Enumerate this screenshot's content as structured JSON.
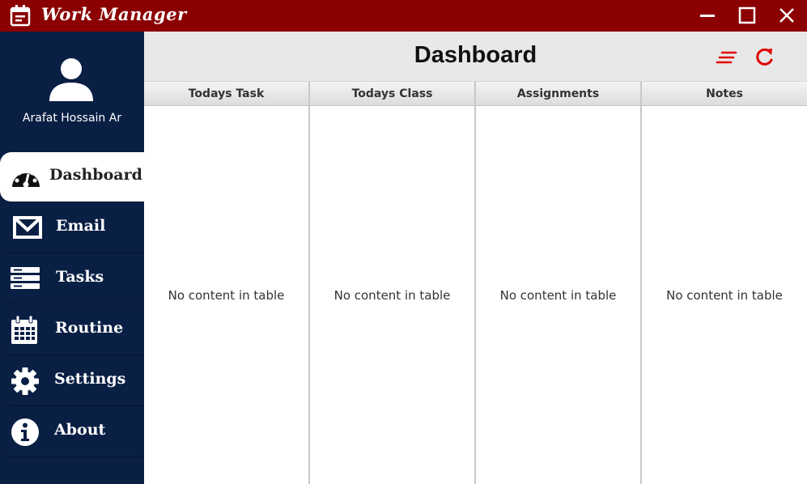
{
  "window": {
    "title": "Work Manager",
    "accent_color": "#8b0000"
  },
  "sidebar": {
    "background": "#0a1f44",
    "user": {
      "name": "Arafat Hossain Ar"
    },
    "items": [
      {
        "label": "Dashboard",
        "icon": "dashboard-gauge-icon",
        "active": true
      },
      {
        "label": "Email",
        "icon": "mail-icon"
      },
      {
        "label": "Tasks",
        "icon": "tasks-icon"
      },
      {
        "label": "Routine",
        "icon": "calendar-icon"
      },
      {
        "label": "Settings",
        "icon": "gear-icon"
      },
      {
        "label": "About",
        "icon": "info-icon"
      }
    ]
  },
  "header": {
    "title": "Dashboard",
    "icon_color": "#e00000"
  },
  "tables": [
    {
      "header": "Todays Task",
      "empty_text": "No content in table"
    },
    {
      "header": "Todays Class",
      "empty_text": "No content in table"
    },
    {
      "header": "Assignments",
      "empty_text": "No content in table"
    },
    {
      "header": "Notes",
      "empty_text": "No content in table"
    }
  ]
}
